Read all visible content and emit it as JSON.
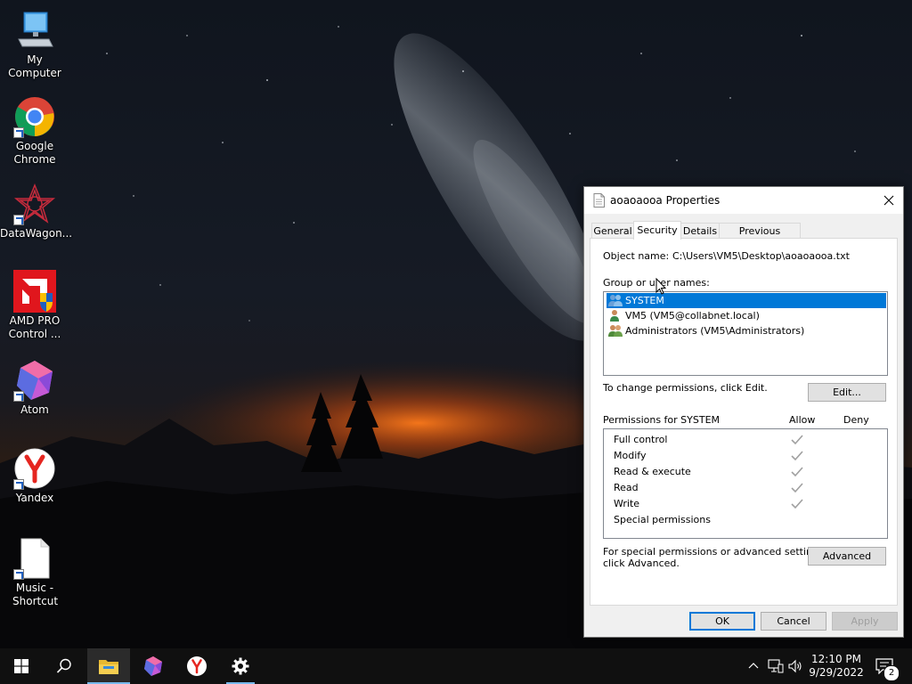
{
  "desktop": {
    "icons": [
      {
        "label": "My Computer",
        "icon": "computer-icon"
      },
      {
        "label": "Google Chrome",
        "icon": "chrome-icon"
      },
      {
        "label": "DataWagon...",
        "icon": "datawagon-icon"
      },
      {
        "label": "AMD PRO Control ...",
        "icon": "amd-icon"
      },
      {
        "label": "Atom",
        "icon": "atom-icon"
      },
      {
        "label": "Yandex",
        "icon": "yandex-icon"
      },
      {
        "label": "Music - Shortcut",
        "icon": "file-icon"
      }
    ]
  },
  "dialog": {
    "title": "aoaoaooa Properties",
    "tabs": [
      {
        "label": "General"
      },
      {
        "label": "Security",
        "active": true
      },
      {
        "label": "Details"
      },
      {
        "label": "Previous Versions"
      }
    ],
    "object_name_label": "Object name:",
    "object_name_value": "C:\\Users\\VM5\\Desktop\\aoaoaooa.txt",
    "group_label": "Group or user names:",
    "users": [
      {
        "name": "SYSTEM",
        "selected": true
      },
      {
        "name": "VM5 (VM5@collabnet.local)"
      },
      {
        "name": "Administrators (VM5\\Administrators)"
      }
    ],
    "change_text": "To change permissions, click Edit.",
    "edit_button": "Edit...",
    "permissions_for": "Permissions for SYSTEM",
    "allow_header": "Allow",
    "deny_header": "Deny",
    "permissions": [
      {
        "name": "Full control",
        "allow": true
      },
      {
        "name": "Modify",
        "allow": true
      },
      {
        "name": "Read & execute",
        "allow": true
      },
      {
        "name": "Read",
        "allow": true
      },
      {
        "name": "Write",
        "allow": true
      },
      {
        "name": "Special permissions",
        "allow": false
      }
    ],
    "advanced_text_line1": "For special permissions or advanced settings,",
    "advanced_text_line2": "click Advanced.",
    "advanced_button": "Advanced",
    "ok_button": "OK",
    "cancel_button": "Cancel",
    "apply_button": "Apply"
  },
  "taskbar": {
    "time": "12:10 PM",
    "date": "9/29/2022",
    "notification_count": "2"
  },
  "colors": {
    "accent": "#0078d7",
    "taskbar": "#101010",
    "check": "#a0a0a0"
  }
}
